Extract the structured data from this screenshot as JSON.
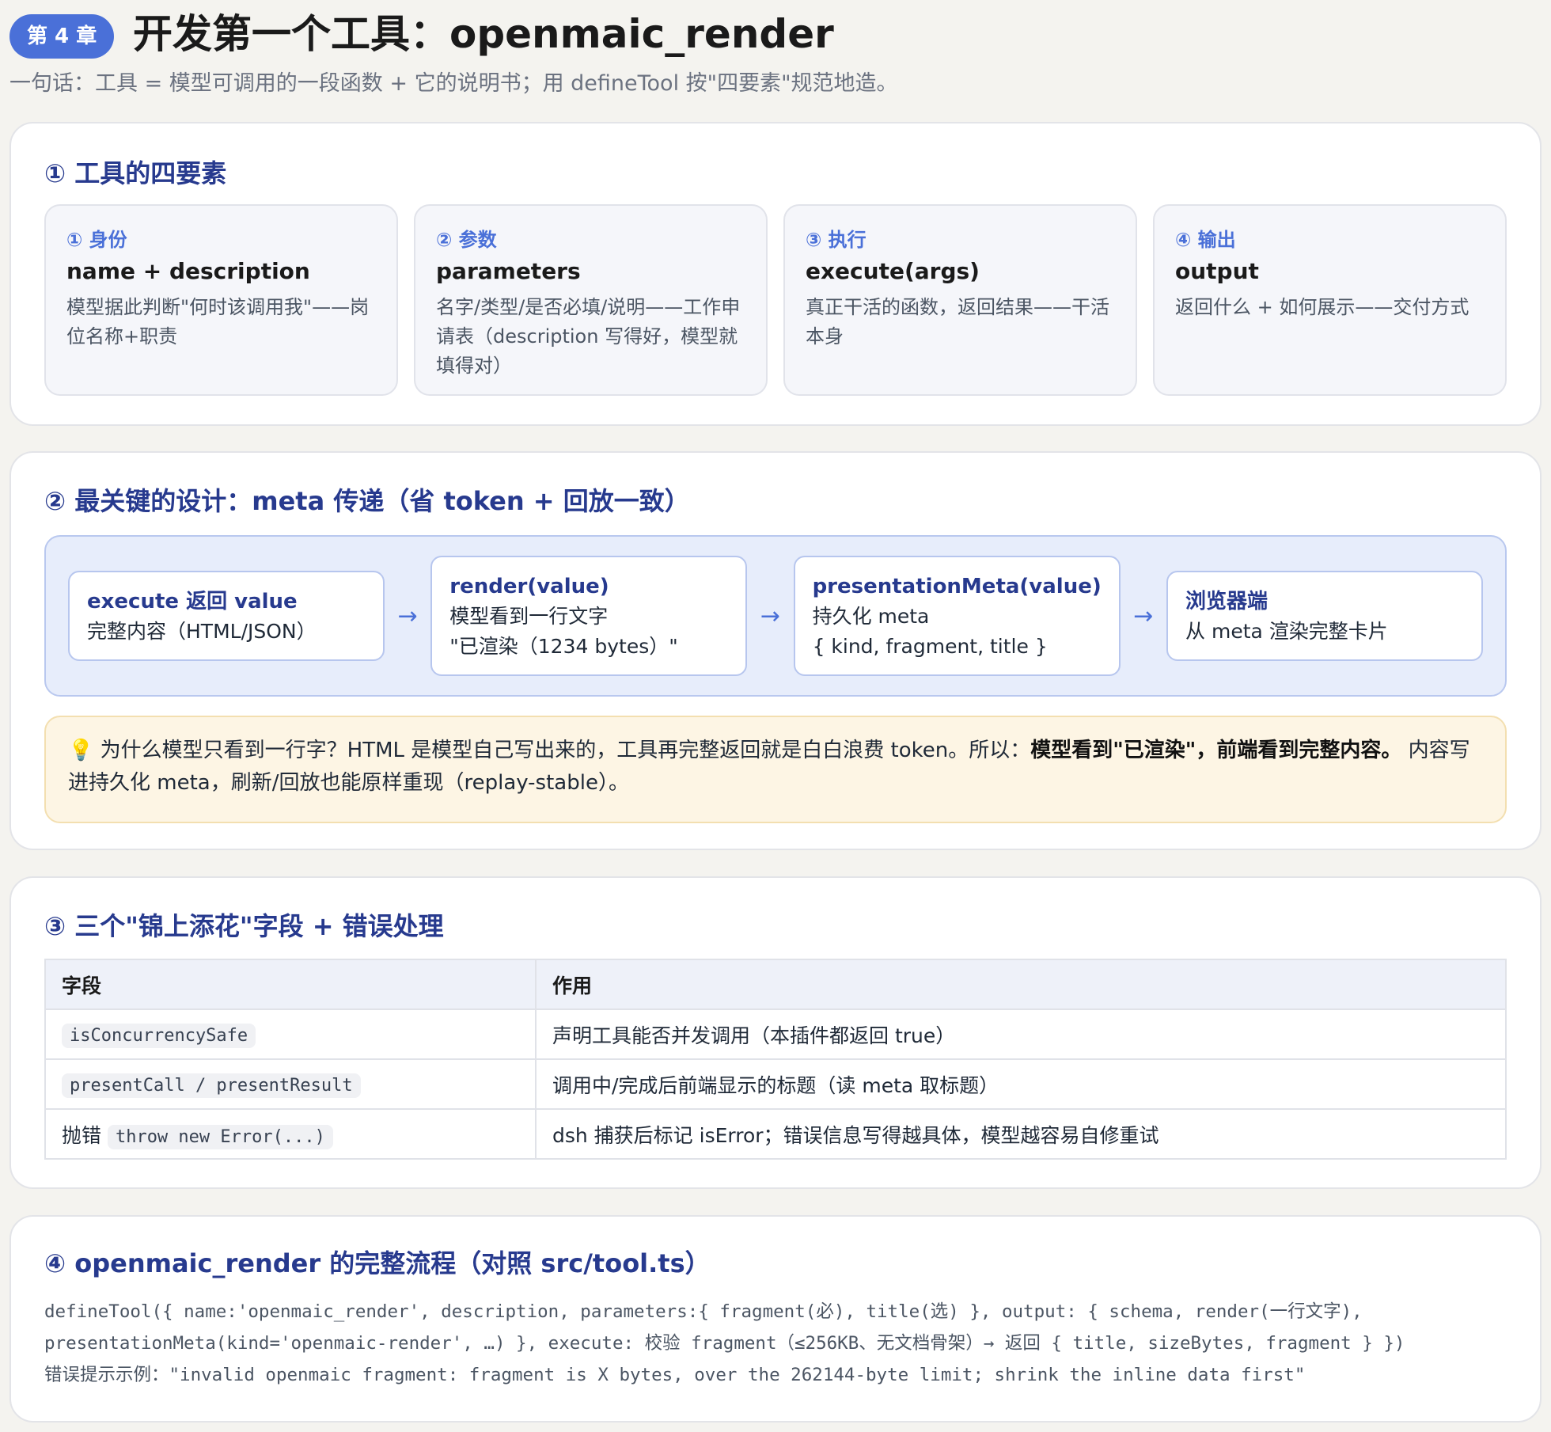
{
  "header": {
    "badge": "第 4 章",
    "title": "开发第一个工具：openmaic_render",
    "subtitle": "一句话：工具 = 模型可调用的一段函数 + 它的说明书；用 defineTool 按\"四要素\"规范地造。"
  },
  "section1": {
    "title": "① 工具的四要素",
    "elements": [
      {
        "num": "① 身份",
        "name": "name + description",
        "desc": "模型据此判断\"何时该调用我\"——岗位名称+职责"
      },
      {
        "num": "② 参数",
        "name": "parameters",
        "desc": "名字/类型/是否必填/说明——工作申请表（description 写得好，模型就填得对）"
      },
      {
        "num": "③ 执行",
        "name": "execute(args)",
        "desc": "真正干活的函数，返回结果——干活本身"
      },
      {
        "num": "④ 输出",
        "name": "output",
        "desc": "返回什么 + 如何展示——交付方式"
      }
    ]
  },
  "section2": {
    "title": "② 最关键的设计：meta 传递（省 token + 回放一致）",
    "flow": [
      {
        "title": "execute 返回 value",
        "lines": [
          "完整内容（HTML/JSON）"
        ]
      },
      {
        "title": "render(value)",
        "lines": [
          "模型看到一行文字",
          "\"已渲染（1234 bytes）\""
        ]
      },
      {
        "title": "presentationMeta(value)",
        "lines": [
          "持久化 meta",
          "{ kind, fragment, title }"
        ]
      },
      {
        "title": "浏览器端",
        "lines": [
          "从 meta 渲染完整卡片"
        ]
      }
    ],
    "arrow": "→",
    "note": {
      "icon": "💡",
      "text1": " 为什么模型只看到一行字？HTML 是模型自己写出来的，工具再完整返回就是白白浪费 token。所以：",
      "bold": "模型看到\"已渲染\"，前端看到完整内容。",
      "text2": " 内容写进持久化 meta，刷新/回放也能原样重现（replay-stable）。"
    }
  },
  "section3": {
    "title": "③ 三个\"锦上添花\"字段 + 错误处理",
    "headers": [
      "字段",
      "作用"
    ],
    "rows": [
      {
        "prefix": "",
        "code": "isConcurrencySafe",
        "desc": "声明工具能否并发调用（本插件都返回 true）"
      },
      {
        "prefix": "",
        "code": "presentCall / presentResult",
        "desc": "调用中/完成后前端显示的标题（读 meta 取标题）"
      },
      {
        "prefix": "抛错 ",
        "code": "throw new Error(...)",
        "desc": "dsh 捕获后标记 isError；错误信息写得越具体，模型越容易自修重试"
      }
    ]
  },
  "section4": {
    "title": "④ openmaic_render 的完整流程（对照 src/tool.ts）",
    "code_lines": [
      "defineTool({ name:'openmaic_render', description, parameters:{ fragment(必), title(选) },   output: { schema, render(一行文字),",
      "presentationMeta(kind='openmaic-render', …) },   execute: 校验 fragment（≤256KB、无文档骨架）→ 返回 { title, sizeBytes, fragment } })",
      "错误提示示例：\"invalid openmaic fragment: fragment is X bytes, over the 262144-byte limit; shrink the inline data first\""
    ]
  }
}
